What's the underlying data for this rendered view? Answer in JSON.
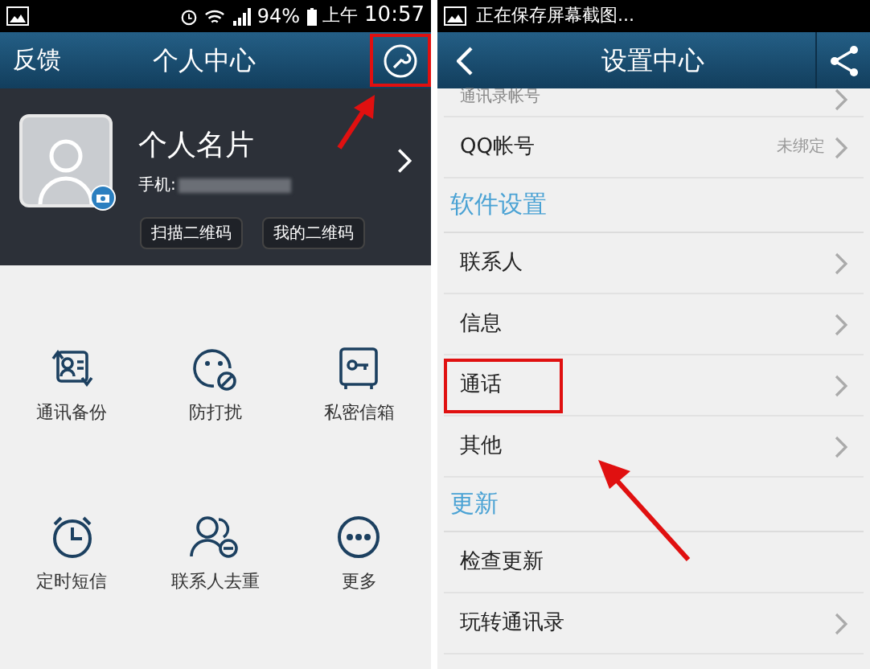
{
  "left_screen": {
    "status_bar": {
      "battery": "94%",
      "period": "上午",
      "time": "10:57"
    },
    "header": {
      "left_link": "反馈",
      "title": "个人中心",
      "tool_button_annotated": true
    },
    "profile": {
      "name": "个人名片",
      "phone_label": "手机:",
      "buttons": [
        "扫描二维码",
        "我的二维码"
      ]
    },
    "tools": [
      {
        "label": "通讯备份",
        "kind": "backup"
      },
      {
        "label": "防打扰",
        "kind": "block"
      },
      {
        "label": "私密信箱",
        "kind": "safe"
      },
      {
        "label": "定时短信",
        "kind": "alarm"
      },
      {
        "label": "联系人去重",
        "kind": "dedupe"
      },
      {
        "label": "更多",
        "kind": "more"
      }
    ]
  },
  "right_screen": {
    "status_bar": {
      "notice": "正在保存屏幕截图..."
    },
    "header": {
      "title": "设置中心"
    },
    "list": [
      {
        "kind": "row",
        "label": "通讯录帐号",
        "chevron": true,
        "annotated": false
      },
      {
        "kind": "row",
        "label": "QQ帐号",
        "value": "未绑定",
        "chevron": true,
        "annotated": false
      },
      {
        "kind": "section",
        "label": "软件设置"
      },
      {
        "kind": "row",
        "label": "联系人",
        "chevron": true,
        "annotated": false
      },
      {
        "kind": "row",
        "label": "信息",
        "chevron": true,
        "annotated": false
      },
      {
        "kind": "row",
        "label": "通话",
        "chevron": true,
        "annotated": true
      },
      {
        "kind": "row",
        "label": "其他",
        "chevron": true,
        "annotated": false
      },
      {
        "kind": "section",
        "label": "更新"
      },
      {
        "kind": "row",
        "label": "检查更新",
        "chevron": false,
        "annotated": false
      },
      {
        "kind": "row",
        "label": "玩转通讯录",
        "chevron": true,
        "annotated": false
      }
    ]
  }
}
